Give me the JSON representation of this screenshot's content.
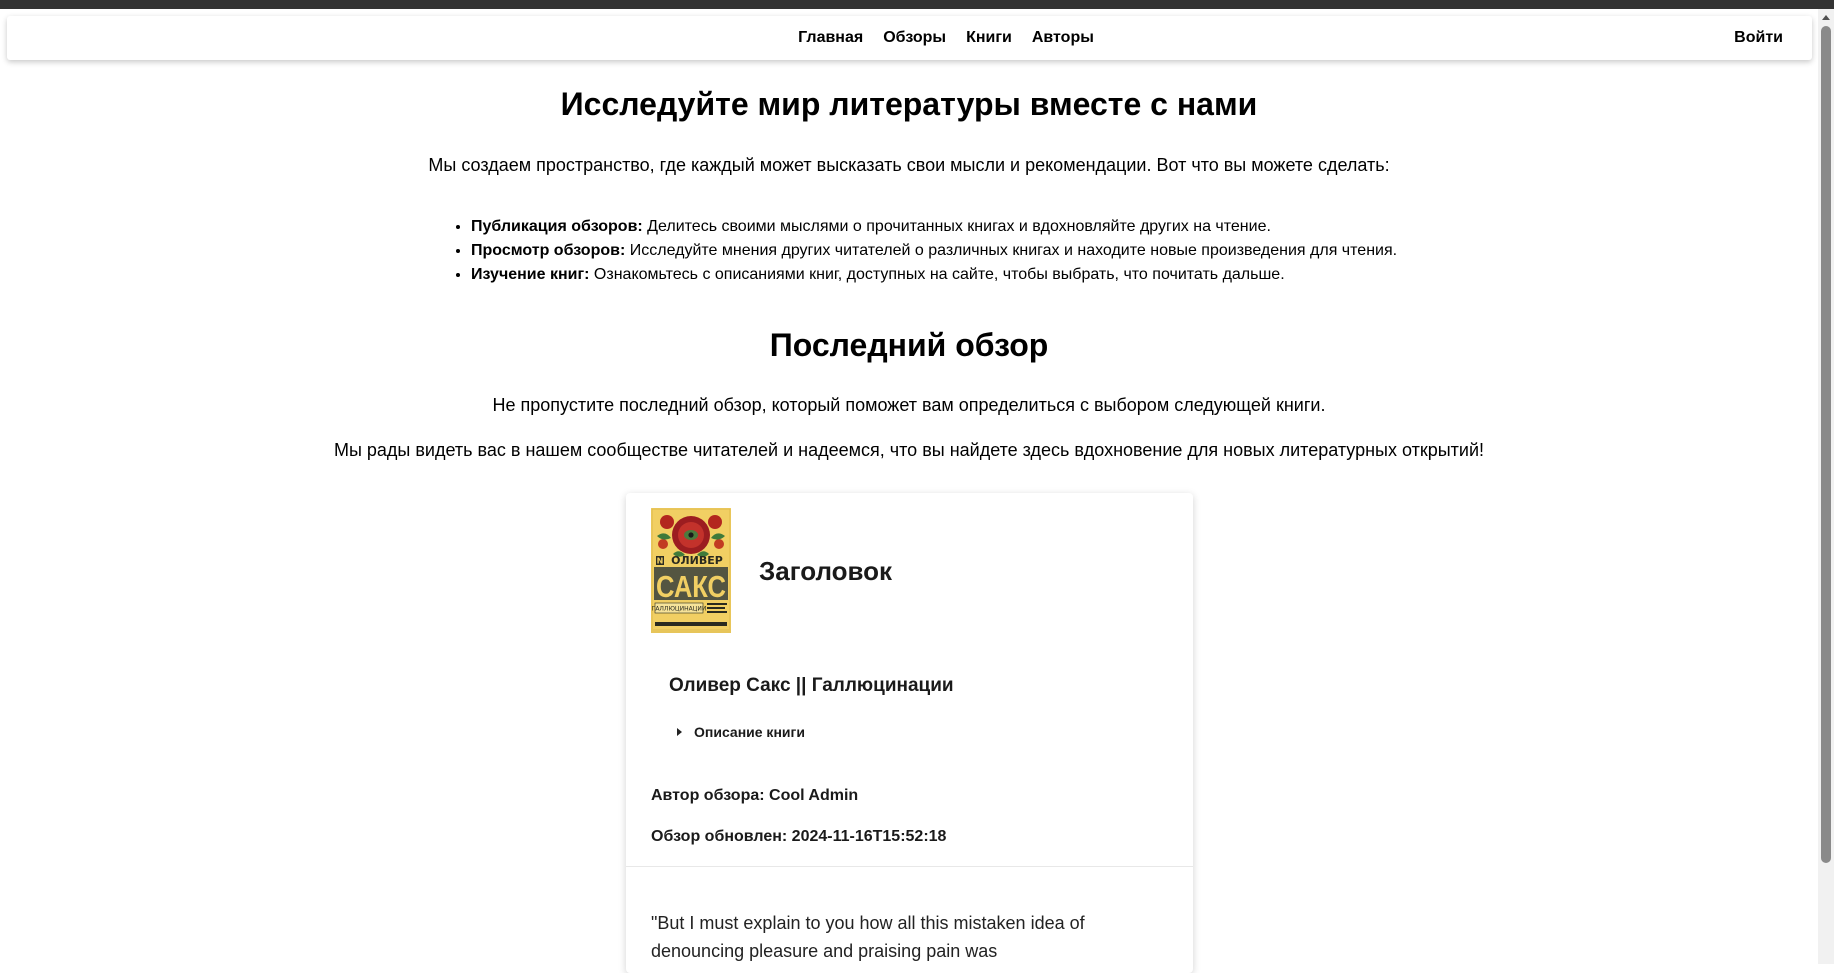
{
  "nav": {
    "links": [
      "Главная",
      "Обзоры",
      "Книги",
      "Авторы"
    ],
    "login": "Войти"
  },
  "hero": {
    "title": "Исследуйте мир литературы вместе с нами",
    "text": "Мы создаем пространство, где каждый может высказать свои мысли и рекомендации. Вот что вы можете сделать:",
    "features": [
      {
        "title": "Публикация обзоров:",
        "text": " Делитесь своими мыслями о прочитанных книгах и вдохновляйте других на чтение."
      },
      {
        "title": "Просмотр обзоров:",
        "text": " Исследуйте мнения других читателей о различных книгах и находите новые произведения для чтения."
      },
      {
        "title": "Изучение книг:",
        "text": " Ознакомьтесь с описаниями книг, доступных на сайте, чтобы выбрать, что почитать дальше."
      }
    ]
  },
  "latest": {
    "title": "Последний обзор",
    "text1": "Не пропустите последний обзор, который поможет вам определиться с выбором следующей книги.",
    "text2": "Мы рады видеть вас в нашем сообществе читателей и надеемся, что вы найдете здесь вдохновение для новых литературных открытий!"
  },
  "review": {
    "heading": "Заголовок",
    "book": "Оливер Сакс || Галлюцинации",
    "description_toggle": "Описание книги",
    "author": "Автор обзора: Cool Admin",
    "updated": "Обзор обновлен: 2024-11-16T15:52:18",
    "body": "\"But I must explain to you how all this mistaken idea of denouncing pleasure and praising pain was",
    "cover": {
      "series_mark": "N",
      "author_upper": "ОЛИВЕР",
      "author_big": "САКС",
      "title_small": "ГАЛЛЮЦИНАЦИИ"
    }
  }
}
